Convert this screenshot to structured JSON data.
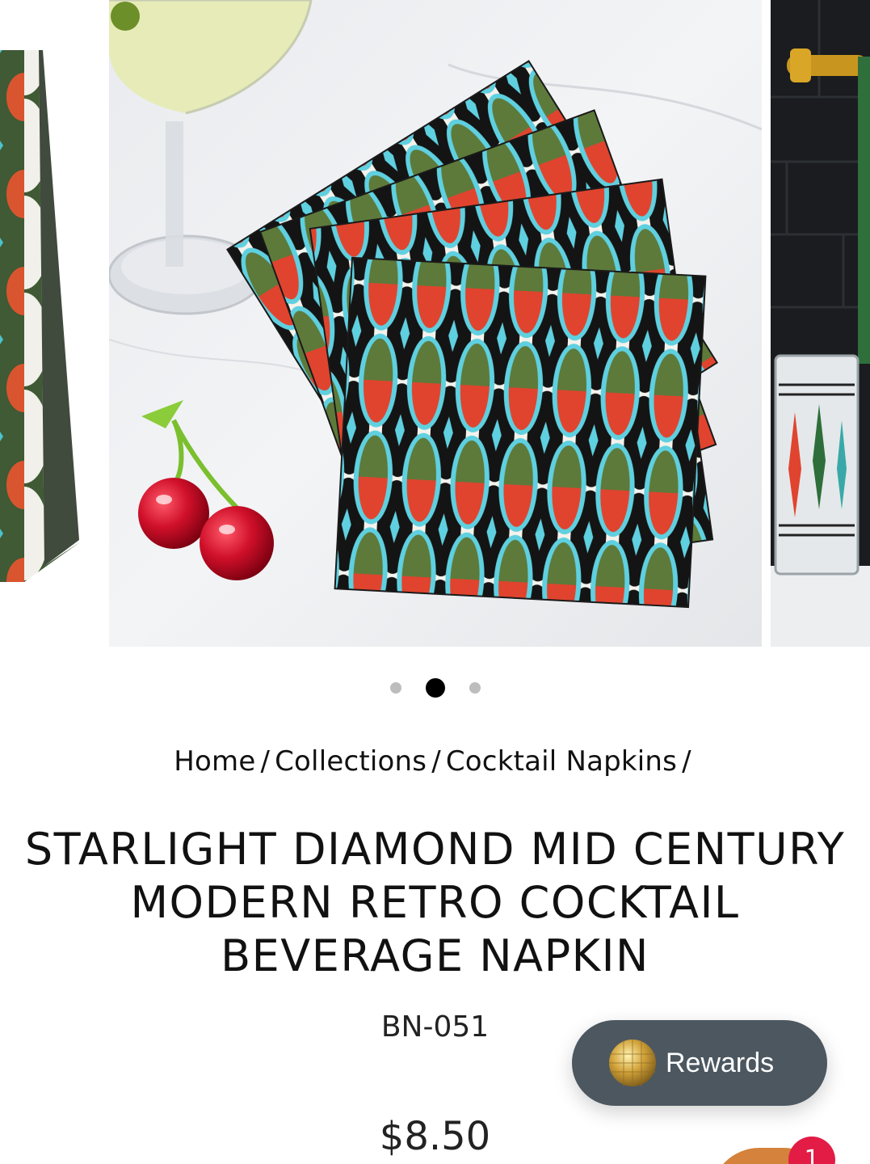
{
  "gallery": {
    "active_index": 1,
    "slide_count": 3,
    "zoom_icon": "search-icon"
  },
  "breadcrumb": {
    "items": [
      "Home",
      "Collections",
      "Cocktail Napkins"
    ],
    "separator": "/"
  },
  "product": {
    "title": "STARLIGHT DIAMOND MID CENTURY MODERN RETRO COCKTAIL BEVERAGE NAPKIN",
    "sku": "BN-051",
    "price": "$8.50"
  },
  "rewards": {
    "label": "Rewards",
    "icon": "disco-ball-icon"
  },
  "chat": {
    "badge_count": "1"
  },
  "colors": {
    "napkin_green": "#5d7a3a",
    "napkin_red": "#e0442e",
    "napkin_cyan": "#5fd0e0",
    "napkin_black": "#141414",
    "rewards_bg": "#4c5760",
    "badge_red": "#e21c45"
  }
}
